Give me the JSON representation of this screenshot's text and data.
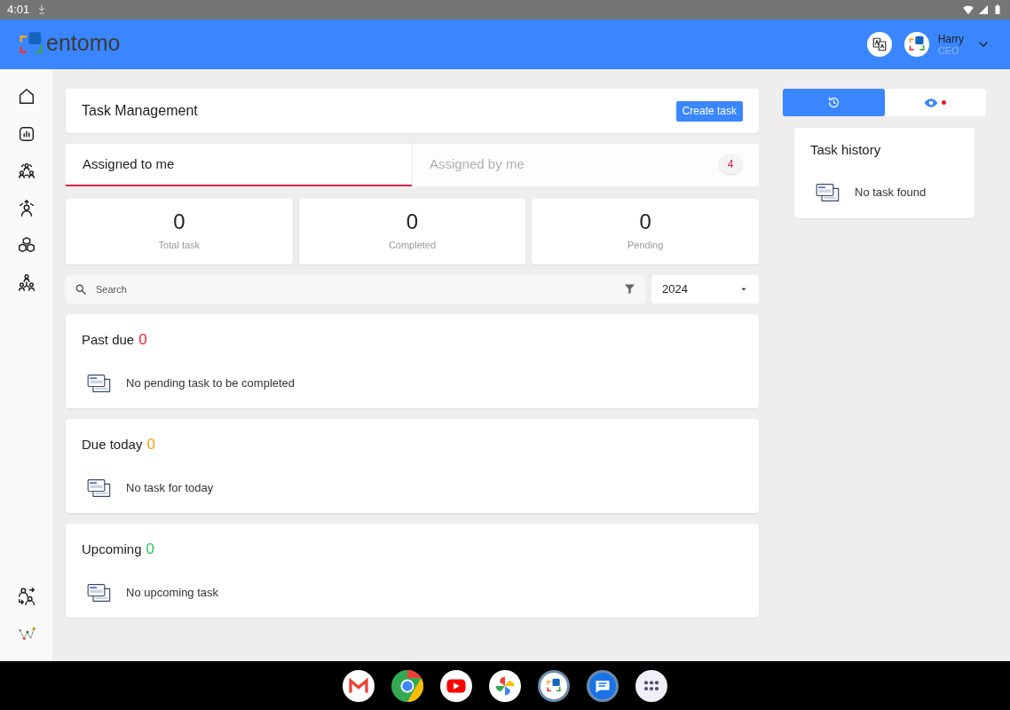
{
  "status_bar": {
    "time": "4:01"
  },
  "header": {
    "logo_text": "entomo",
    "user": {
      "name": "Harry",
      "role": "CEO"
    }
  },
  "sidebar": {
    "items": [
      {
        "kind": "home"
      },
      {
        "kind": "chart"
      },
      {
        "kind": "team"
      },
      {
        "kind": "person-up"
      },
      {
        "kind": "boxes"
      },
      {
        "kind": "hierarchy"
      }
    ],
    "bottom_items": [
      {
        "kind": "swap"
      },
      {
        "kind": "graph"
      }
    ]
  },
  "page": {
    "title": "Task Management",
    "create_button": "Create task"
  },
  "tabs": [
    {
      "label": "Assigned to me",
      "selected": true
    },
    {
      "label": "Assigned by me",
      "selected": false,
      "badge": "4"
    }
  ],
  "stats": [
    {
      "value": "0",
      "label": "Total task"
    },
    {
      "value": "0",
      "label": "Completed"
    },
    {
      "value": "0",
      "label": "Pending"
    }
  ],
  "search": {
    "placeholder": "Search"
  },
  "year_select": {
    "value": "2024"
  },
  "sections": [
    {
      "title": "Past due",
      "count": "0",
      "color": "#ef1c2b",
      "empty_message": "No pending task to be completed"
    },
    {
      "title": "Due today",
      "count": "0",
      "color": "#f59e0b",
      "empty_message": "No task for today"
    },
    {
      "title": "Upcoming",
      "count": "0",
      "color": "#22c55e",
      "empty_message": "No upcoming task"
    }
  ],
  "side_toggles": [
    {
      "kind": "history",
      "selected": true,
      "alert": false
    },
    {
      "kind": "view",
      "selected": false,
      "alert": true
    }
  ],
  "task_history": {
    "title": "Task history",
    "empty_message": "No task found"
  },
  "dock": [
    {
      "kind": "mail"
    },
    {
      "kind": "browser"
    },
    {
      "kind": "video"
    },
    {
      "kind": "photos"
    },
    {
      "kind": "entomo"
    },
    {
      "kind": "messages"
    },
    {
      "kind": "apps"
    }
  ]
}
